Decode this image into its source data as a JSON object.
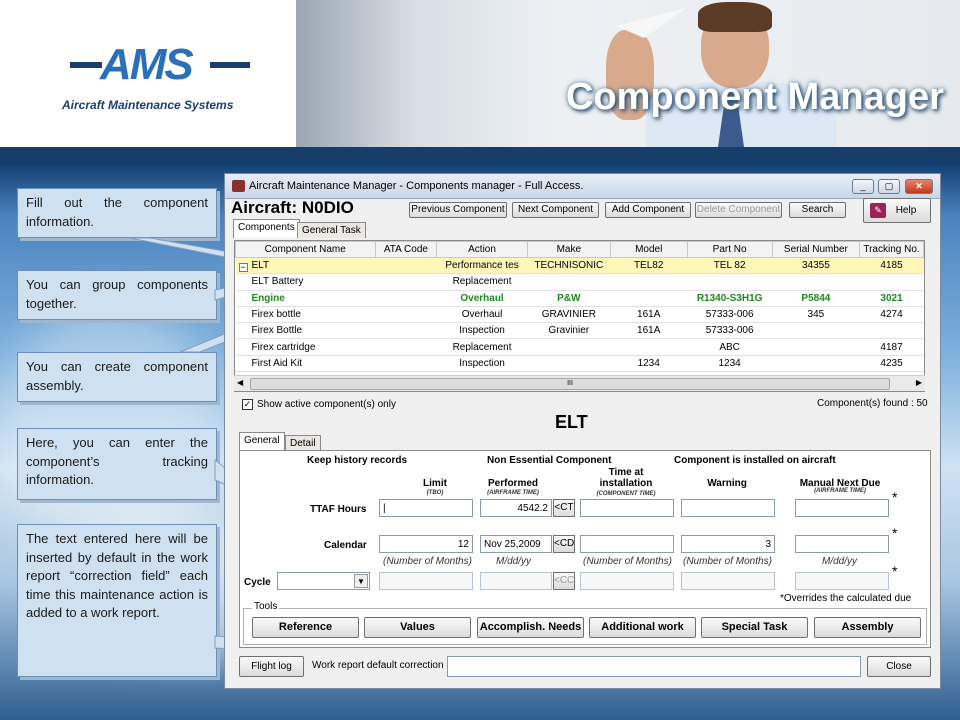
{
  "header": {
    "logo_text": "AMS",
    "logo_subtitle": "Aircraft Maintenance Systems",
    "page_title": "Component Manager"
  },
  "notes": [
    "Fill out the component information.",
    "You can group components together.",
    "You can create component assembly.",
    "Here, you can enter the component’s tracking information.",
    "The text entered here will be inserted by default in the work report “correction field” each time this maintenance action is added to a work report."
  ],
  "window": {
    "title": "Aircraft Maintenance Manager - Components manager - Full Access.",
    "aircraft_label": "Aircraft: N0DIO",
    "toolbar": {
      "previous": "Previous Component",
      "next": "Next Component",
      "add": "Add Component",
      "delete": "Delete Component",
      "search": "Search",
      "help": "Help"
    },
    "top_tabs": [
      "Components",
      "General Task"
    ],
    "grid": {
      "columns": [
        "Component Name",
        "ATA Code",
        "Action",
        "Make",
        "Model",
        "Part No",
        "Serial Number",
        "Tracking No."
      ],
      "rows": [
        {
          "name": "ELT",
          "ata": "",
          "action": "Performance tes",
          "make": "TECHNISONIC",
          "model": "TEL82",
          "part": "TEL 82",
          "serial": "34355",
          "tracking": "4185"
        },
        {
          "name": "ELT Battery",
          "ata": "",
          "action": "Replacement",
          "make": "",
          "model": "",
          "part": "",
          "serial": "",
          "tracking": ""
        },
        {
          "name": "Engine",
          "ata": "",
          "action": "Overhaul",
          "make": "P&W",
          "model": "",
          "part": "R1340-S3H1G",
          "serial": "P5844",
          "tracking": "3021"
        },
        {
          "name": "Firex bottle",
          "ata": "",
          "action": "Overhaul",
          "make": "GRAVINIER",
          "model": "161A",
          "part": "57333-006",
          "serial": "345",
          "tracking": "4274"
        },
        {
          "name": "Firex Bottle",
          "ata": "",
          "action": "Inspection",
          "make": "Gravinier",
          "model": "161A",
          "part": "57333-006",
          "serial": "",
          "tracking": ""
        },
        {
          "name": "Firex cartridge",
          "ata": "",
          "action": "Replacement",
          "make": "",
          "model": "",
          "part": "ABC",
          "serial": "",
          "tracking": "4187"
        },
        {
          "name": "First Aid Kit",
          "ata": "",
          "action": "Inspection",
          "make": "",
          "model": "1234",
          "part": "1234",
          "serial": "",
          "tracking": "4235"
        }
      ],
      "scroll_glyph": "III"
    },
    "show_active_label": "Show active component(s) only",
    "show_active_checked": true,
    "found_label": "Component(s) found : 50",
    "detail_title": "ELT",
    "detail_tabs": [
      "General",
      "Detail"
    ],
    "flags": {
      "keep_history": "Keep history records",
      "non_essential": "Non Essential Component",
      "installed": "Component is installed on aircraft"
    },
    "columns": {
      "limit": "Limit",
      "limit_sub": "(TBO)",
      "performed": "Performed",
      "performed_sub": "(AIRFRAME TIME)",
      "time_at_install": "Time at installation",
      "time_at_install_sub": "(COMPONENT TIME)",
      "warning": "Warning",
      "manual_next_due": "Manual Next Due",
      "manual_next_due_sub": "(AIRFRAME TIME)"
    },
    "rows": {
      "ttaf": {
        "label": "TTAF Hours",
        "limit": "|",
        "performed": "4542.2",
        "btn": "<CT",
        "time_at_install": "",
        "warning": "",
        "manual": ""
      },
      "calendar": {
        "label": "Calendar",
        "limit": "12",
        "performed": "Nov 25,2009",
        "btn": "<CD",
        "time_at_install": "",
        "warning": "3",
        "manual": "",
        "hints": [
          "(Number of Months)",
          "M/dd/yy",
          "(Number of Months)",
          "(Number of Months)",
          "M/dd/yy"
        ]
      },
      "cycle": {
        "label": "Cycle",
        "btn": "<CC"
      }
    },
    "overrides_note": "*Overrides the calculated due",
    "star": "*",
    "tools": {
      "label": "Tools",
      "buttons": [
        "Reference",
        "Values",
        "Accomplish. Needs",
        "Additional work",
        "Special Task",
        "Assembly"
      ]
    },
    "footer": {
      "flight_log": "Flight log",
      "correction_label": "Work report default correction",
      "correction_value": "",
      "close": "Close"
    }
  }
}
